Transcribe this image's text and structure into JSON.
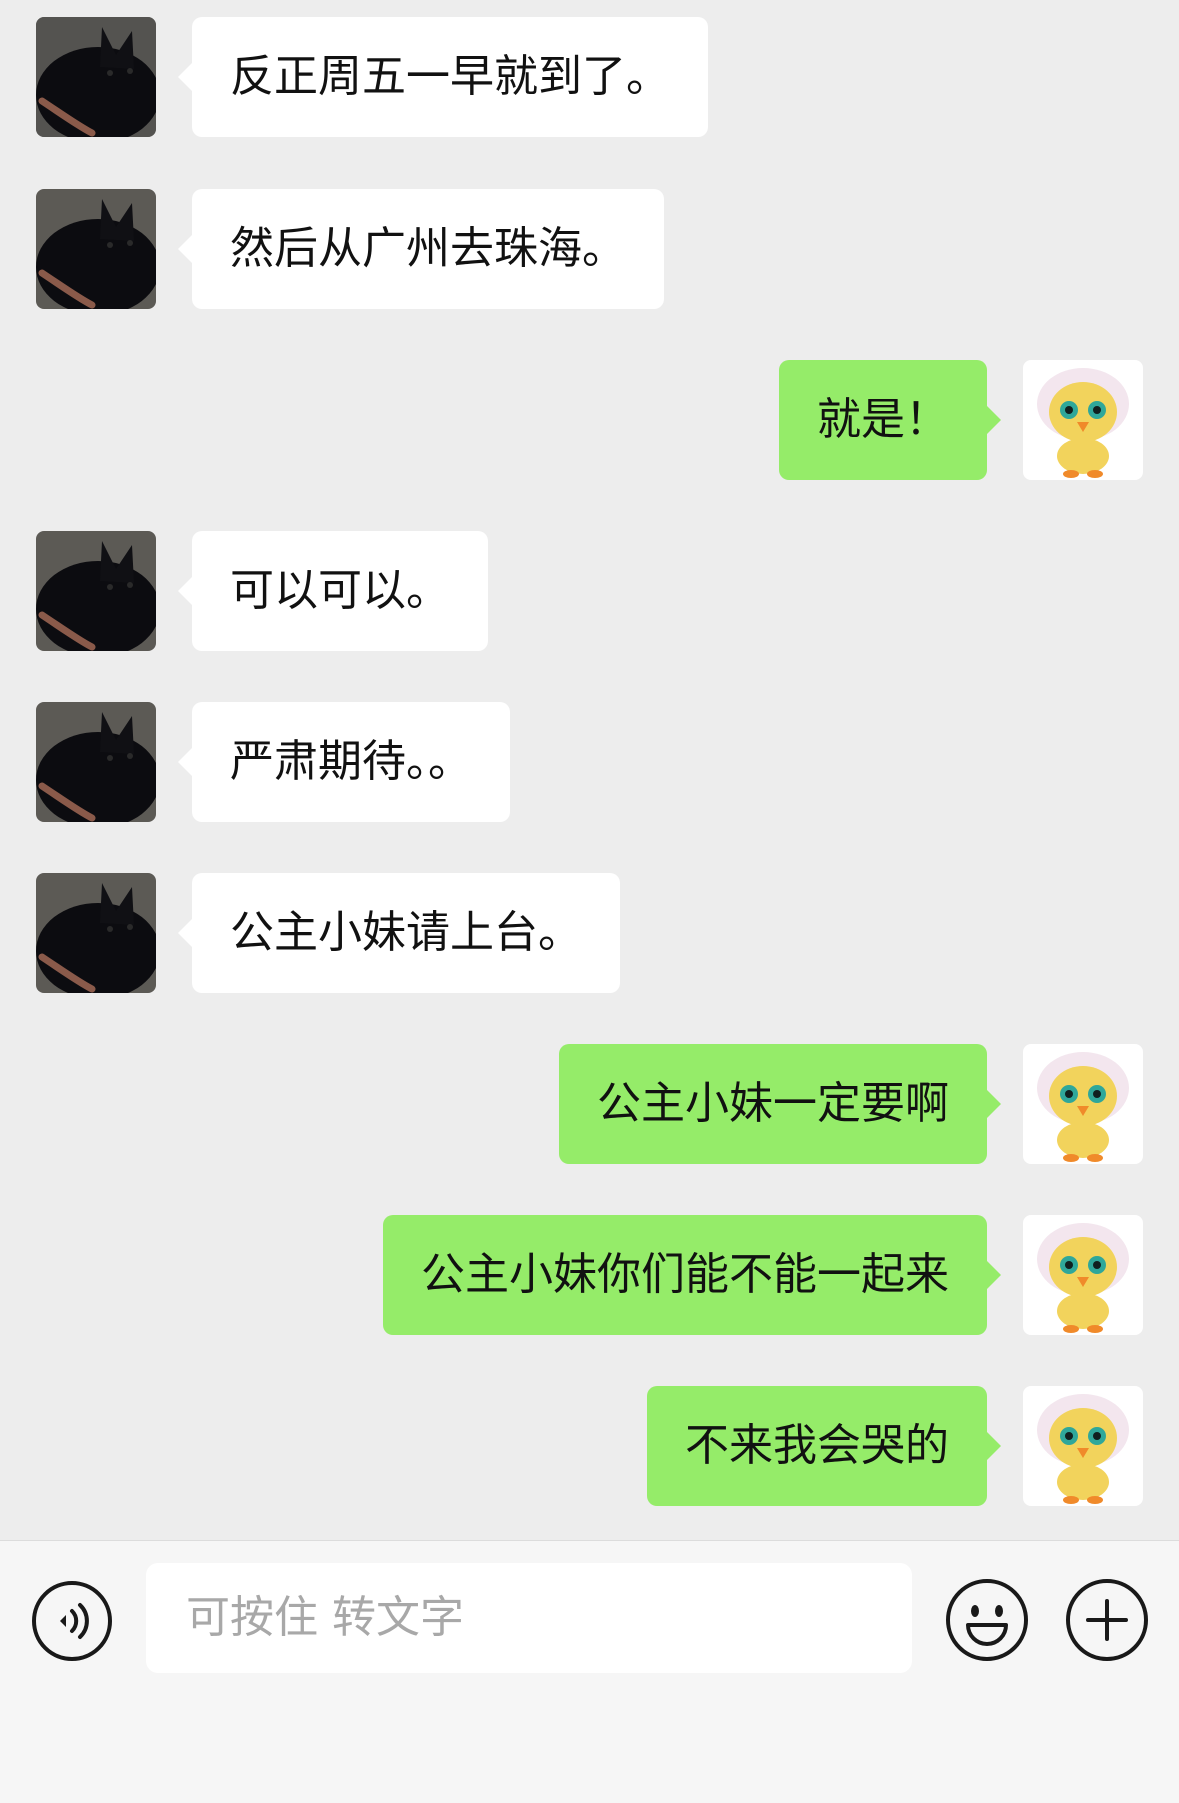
{
  "messages": [
    {
      "side": "left",
      "avatar": "black-cat-avatar",
      "text": "反正周五一早就到了。"
    },
    {
      "side": "left",
      "avatar": "black-cat-avatar",
      "text": "然后从广州去珠海。"
    },
    {
      "side": "right",
      "avatar": "chick-doll-avatar",
      "text": "就是！"
    },
    {
      "side": "left",
      "avatar": "black-cat-avatar",
      "text": "可以可以。"
    },
    {
      "side": "left",
      "avatar": "black-cat-avatar",
      "text": "严肃期待。。"
    },
    {
      "side": "left",
      "avatar": "black-cat-avatar",
      "text": "公主小妹请上台。"
    },
    {
      "side": "right",
      "avatar": "chick-doll-avatar",
      "text": "公主小妹一定要啊"
    },
    {
      "side": "right",
      "avatar": "chick-doll-avatar",
      "text": "公主小妹你们能不能一起来"
    },
    {
      "side": "right",
      "avatar": "chick-doll-avatar",
      "text": "不来我会哭的"
    }
  ],
  "input_bar": {
    "placeholder": "可按住 转文字",
    "voice_icon": "voice-icon",
    "emoji_icon": "emoji-icon",
    "plus_icon": "plus-icon"
  },
  "colors": {
    "background": "#ededed",
    "incoming_bubble": "#ffffff",
    "outgoing_bubble": "#95ec69",
    "input_bar": "#f6f6f6"
  }
}
